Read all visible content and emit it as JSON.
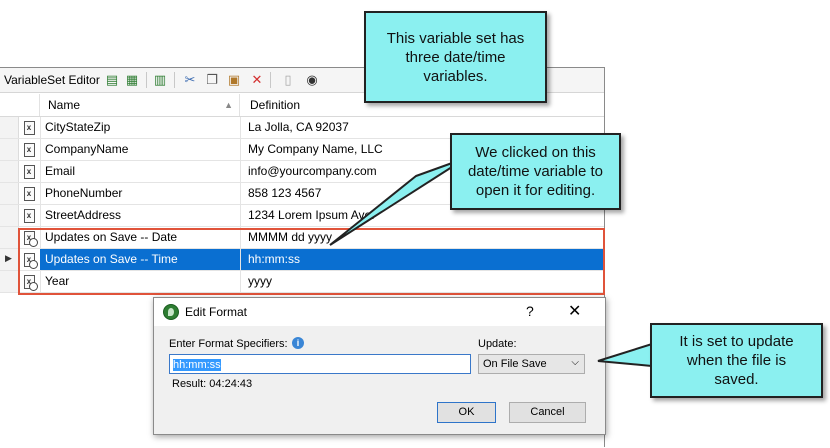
{
  "editor": {
    "title": "VariableSet Editor",
    "columns": {
      "name": "Name",
      "definition": "Definition"
    },
    "rows": [
      {
        "name": "CityStateZip",
        "definition": "La Jolla, CA 92037"
      },
      {
        "name": "CompanyName",
        "definition": "My Company Name, LLC"
      },
      {
        "name": "Email",
        "definition": "info@yourcompany.com"
      },
      {
        "name": "PhoneNumber",
        "definition": "858 123 4567"
      },
      {
        "name": "StreetAddress",
        "definition": "1234 Lorem Ipsum Ave."
      },
      {
        "name": "Updates on Save -- Date",
        "definition": "MMMM dd yyyy"
      },
      {
        "name": "Updates on Save -- Time",
        "definition": "hh:mm:ss"
      },
      {
        "name": "Year",
        "definition": "yyyy"
      }
    ],
    "selected_row_index": 6
  },
  "dialog": {
    "title": "Edit Format",
    "help": "?",
    "close": "✕",
    "format_label": "Enter Format Specifiers:",
    "format_value": "hh:mm:ss",
    "result": "Result: 04:24:43",
    "update_label": "Update:",
    "update_value": "On File Save",
    "ok_label": "OK",
    "cancel_label": "Cancel"
  },
  "callouts": {
    "one": "This variable set has three date/time variables.",
    "two": "We clicked on this date/time variable to open it for editing.",
    "three": "It is set to update when the file is saved."
  },
  "colors": {
    "callout_fill": "#8bf0f0",
    "highlight_border": "#e0533a",
    "selection": "#0a6fd1"
  }
}
